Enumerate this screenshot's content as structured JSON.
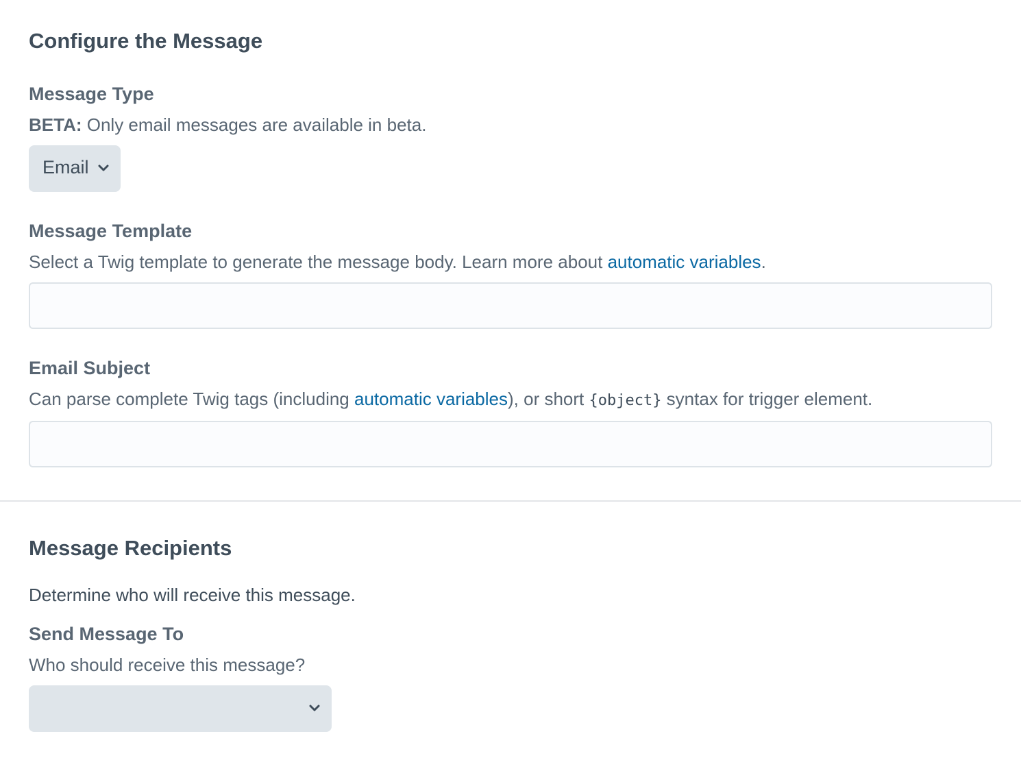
{
  "configure_section": {
    "title": "Configure the Message",
    "message_type": {
      "label": "Message Type",
      "instructions_prefix": "BETA:",
      "instructions_text": " Only email messages are available in beta.",
      "selected_value": "Email"
    },
    "message_template": {
      "label": "Message Template",
      "instructions_text": "Select a Twig template to generate the message body. Learn more about ",
      "link_text": "automatic variables",
      "instructions_suffix": ".",
      "value": "",
      "placeholder": ""
    },
    "email_subject": {
      "label": "Email Subject",
      "instructions_text": "Can parse complete Twig tags (including ",
      "link_text": "automatic variables",
      "instructions_mid": "), or short ",
      "code_text": "{object}",
      "instructions_suffix": " syntax for trigger element.",
      "value": "",
      "placeholder": ""
    }
  },
  "recipients_section": {
    "title": "Message Recipients",
    "intro": "Determine who will receive this message.",
    "send_to": {
      "label": "Send Message To",
      "instructions_text": "Who should receive this message?",
      "selected_value": ""
    }
  },
  "icons": {
    "dropdown": "chevron-down-icon"
  },
  "colors": {
    "heading": "#3f4d5a",
    "label": "#596673",
    "link": "#0b69a3",
    "select_bg": "#dfe5ea",
    "input_bg": "#fbfcfe",
    "input_border": "#dde3e8",
    "divider": "#e3e5e8"
  }
}
